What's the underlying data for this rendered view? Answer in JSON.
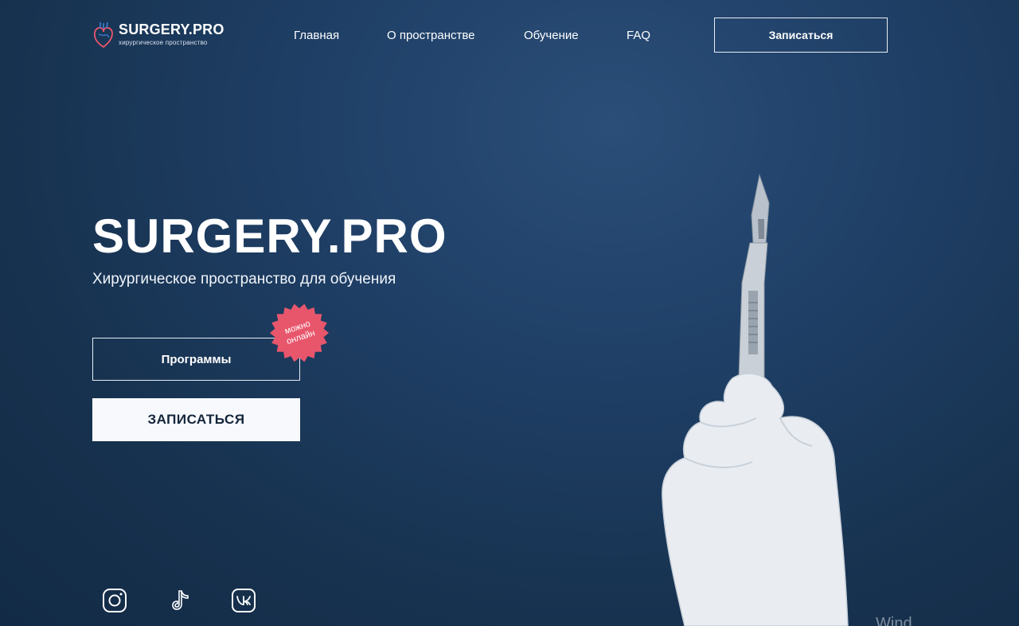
{
  "header": {
    "logo": {
      "title": "SURGERY.PRO",
      "subtitle": "хирургическое пространство",
      "icon": "heart-anatomy-icon"
    },
    "nav": [
      {
        "label": "Главная"
      },
      {
        "label": "О пространстве"
      },
      {
        "label": "Обучение"
      },
      {
        "label": "FAQ"
      }
    ],
    "signup_label": "Записаться"
  },
  "hero": {
    "title": "SURGERY.PRO",
    "subtitle": "Хирургическое пространство для обучения",
    "programs_label": "Программы",
    "badge": {
      "line1": "можно",
      "line2": "онлайн",
      "color": "#e8566c"
    },
    "signup_label": "ЗАПИСАТЬСЯ"
  },
  "social": [
    {
      "icon": "instagram-icon"
    },
    {
      "icon": "tiktok-icon"
    },
    {
      "icon": "vk-icon"
    }
  ],
  "watermark": "Wind",
  "colors": {
    "background": "#1f3f66",
    "accent": "#e8566c",
    "button_light": "#f7f9fc"
  }
}
